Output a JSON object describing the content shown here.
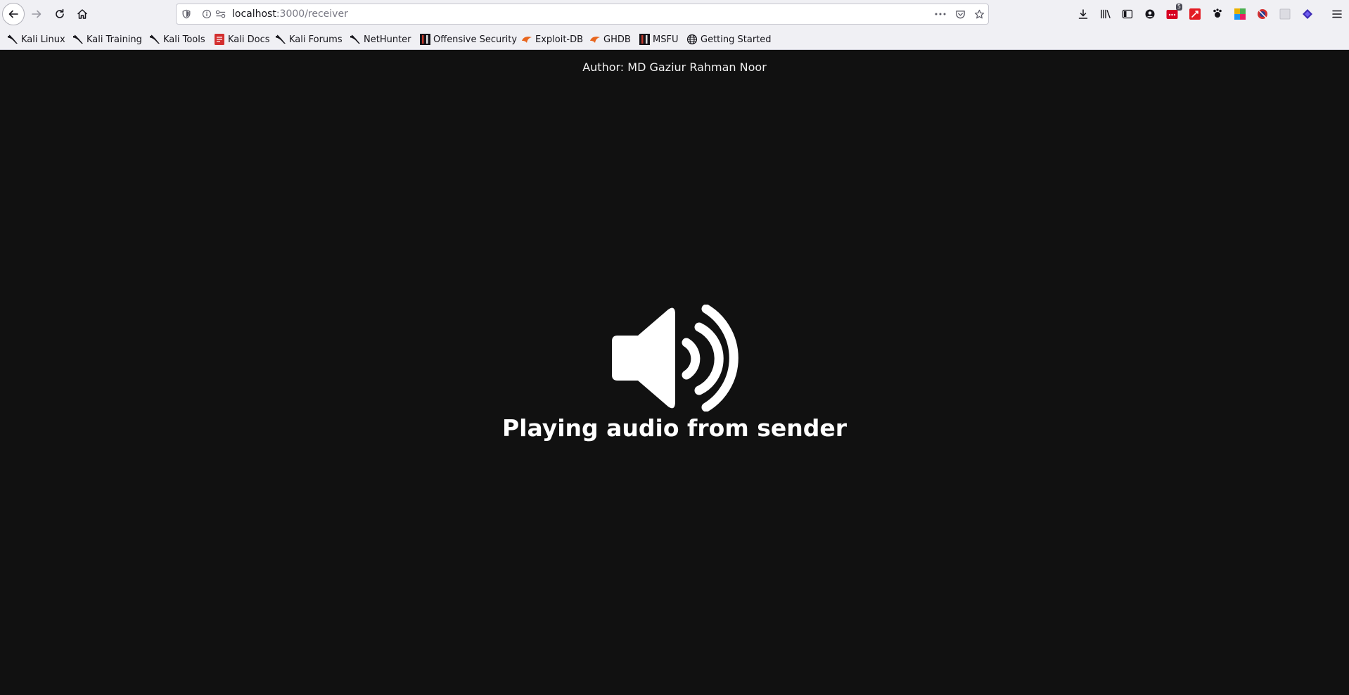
{
  "browser": {
    "url": {
      "host": "localhost",
      "path": ":3000/receiver"
    },
    "nav_icons": [
      "back-arrow-icon",
      "forward-arrow-icon",
      "reload-icon",
      "home-icon"
    ],
    "toolbar_icons": [
      "download-icon",
      "library-icon",
      "sidebar-icon",
      "account-icon",
      "extension-icon",
      "extension-icon",
      "extension-icon",
      "extension-icon",
      "extension-icon",
      "extension-icon",
      "extension-icon",
      "menu-icon"
    ],
    "extension_badge": "5"
  },
  "bookmarks": [
    {
      "label": "Kali Linux",
      "icon": "kali-dragon-icon"
    },
    {
      "label": "Kali Training",
      "icon": "kali-dragon-icon"
    },
    {
      "label": "Kali Tools",
      "icon": "kali-dragon-icon"
    },
    {
      "label": "Kali Docs",
      "icon": "kali-docs-icon"
    },
    {
      "label": "Kali Forums",
      "icon": "kali-dragon-icon"
    },
    {
      "label": "NetHunter",
      "icon": "kali-dragon-icon"
    },
    {
      "label": "Offensive Security",
      "icon": "offsec-icon"
    },
    {
      "label": "Exploit-DB",
      "icon": "exploit-db-icon"
    },
    {
      "label": "GHDB",
      "icon": "exploit-db-icon"
    },
    {
      "label": "MSFU",
      "icon": "offsec-icon"
    },
    {
      "label": "Getting Started",
      "icon": "globe-icon"
    }
  ],
  "page": {
    "author": "Author: MD Gaziur Rahman Noor",
    "status": "Playing audio from sender",
    "icon": "speaker-volume-icon"
  },
  "colors": {
    "page_background": "#111111",
    "chrome_background": "#f0f0f4",
    "text_primary": "#ffffff"
  }
}
